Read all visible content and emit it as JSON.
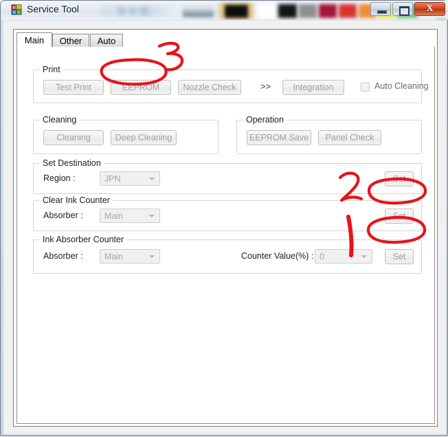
{
  "window": {
    "title": "Service Tool",
    "icon": "app-blocks-icon",
    "controls": {
      "minimize": "minimize-icon",
      "maximize": "maximize-icon",
      "close": "X"
    },
    "obscured_swatch_colors": [
      "#8b98a4",
      "#e8c98a",
      "#111111",
      "#ffffff",
      "#1a1a1a",
      "#8c8c8c",
      "#a5133a",
      "#d8342f",
      "#ef8b3c",
      "#f2e63c",
      "#6cc06a"
    ]
  },
  "tabs": [
    {
      "label": "Main",
      "active": true
    },
    {
      "label": "Other",
      "active": false
    },
    {
      "label": "Auto",
      "active": false
    }
  ],
  "groups": {
    "print": {
      "title": "Print",
      "test_print": "Test Print",
      "eeprom": "EEPROM",
      "nozzle_check": "Nozzle Check",
      "chevrons": ">>",
      "integration": "Integration",
      "auto_cleaning": "Auto Cleaning",
      "auto_cleaning_checked": false
    },
    "cleaning": {
      "title": "Cleaning",
      "cleaning": "Cleaning",
      "deep_cleaning": "Deep Cleaning"
    },
    "operation": {
      "title": "Operation",
      "eeprom_save": "EEPROM Save",
      "panel_check": "Panel Check"
    },
    "set_destination": {
      "title": "Set Destination",
      "region_label": "Region :",
      "region_value": "JPN",
      "set": "Set"
    },
    "clear_ink_counter": {
      "title": "Clear Ink Counter",
      "absorber_label": "Absorber :",
      "absorber_value": "Main",
      "set": "Set"
    },
    "ink_absorber_counter": {
      "title": "Ink Absorber Counter",
      "absorber_label": "Absorber :",
      "absorber_value": "Main",
      "counter_label": "Counter Value(%) :",
      "counter_value": "0",
      "set": "Set"
    }
  },
  "annotations": {
    "color": "#e8131a",
    "marks": [
      {
        "text": "3",
        "target": "eeprom-button"
      },
      {
        "text": "2",
        "target": "clear-ink-counter-set-button"
      },
      {
        "text": "1",
        "target": "ink-absorber-counter-set-button"
      }
    ]
  }
}
